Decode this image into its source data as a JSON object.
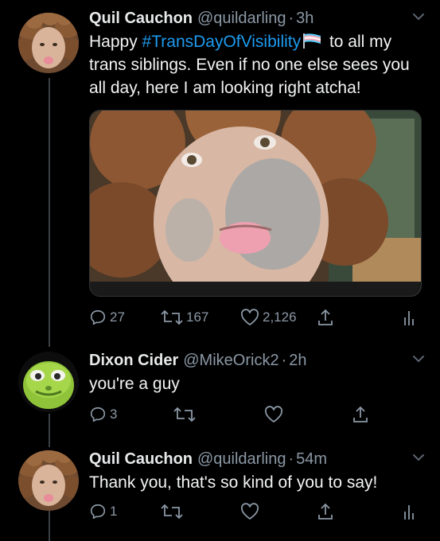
{
  "tweets": [
    {
      "display_name": "Quil Cauchon",
      "handle": "@quildarling",
      "separator": "·",
      "time": "3h",
      "text_before": "Happy ",
      "hashtag": "#TransDayOfVisibility",
      "flag_icon": "transgender-flag-icon",
      "text_after_line1": " to all my",
      "text_rest": "trans siblings. Even if no one else sees you all day, here I am looking right atcha!",
      "replies": "27",
      "retweets": "167",
      "likes": "2,126"
    },
    {
      "display_name": "Dixon Cider",
      "handle": "@MikeOrick2",
      "separator": "·",
      "time": "2h",
      "text": "you're a guy",
      "replies": "3"
    },
    {
      "display_name": "Quil Cauchon",
      "handle": "@quildarling",
      "separator": "·",
      "time": "54m",
      "text": "Thank you, that's so kind of you to say!",
      "replies": "1"
    }
  ],
  "icons": {
    "reply": "reply-icon",
    "retweet": "retweet-icon",
    "like": "heart-icon",
    "share": "share-icon",
    "analytics": "analytics-icon",
    "caret": "chevron-down-icon"
  },
  "colors": {
    "background": "#000000",
    "text": "#e7e9ea",
    "secondary": "#8b98a5",
    "link": "#1d9bf0"
  }
}
